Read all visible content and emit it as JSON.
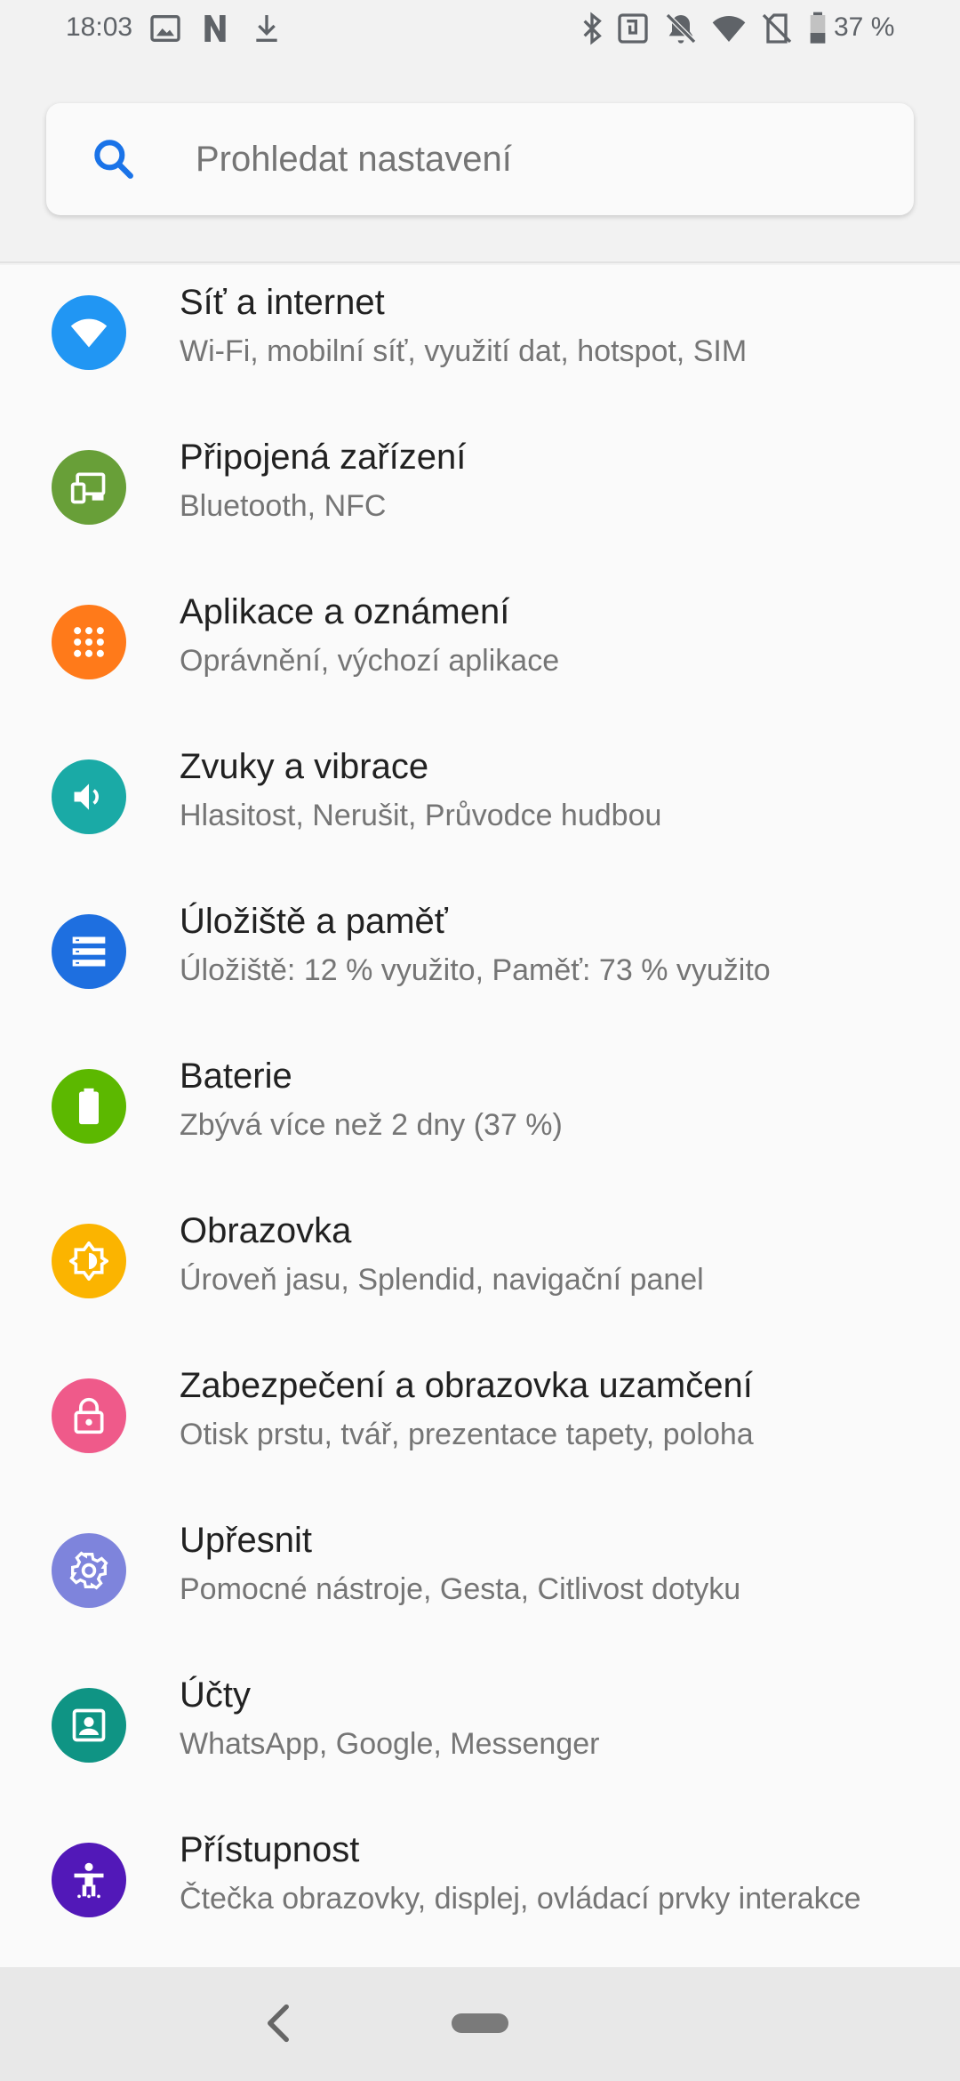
{
  "status_bar": {
    "time": "18:03",
    "battery_text": "37 %",
    "icons": [
      "image-icon",
      "n-app-icon",
      "download-icon",
      "bluetooth-icon",
      "nfc-icon",
      "mute-icon",
      "wifi-icon",
      "no-sim-icon",
      "battery-icon"
    ]
  },
  "search": {
    "placeholder": "Prohledat nastavení"
  },
  "settings": [
    {
      "title": "Síť a internet",
      "subtitle": "Wi-Fi, mobilní síť, využití dat, hotspot, SIM",
      "icon": "wifi-icon",
      "color": "#2196f3"
    },
    {
      "title": "Připojená zařízení",
      "subtitle": "Bluetooth, NFC",
      "icon": "devices-icon",
      "color": "#689f38"
    },
    {
      "title": "Aplikace a oznámení",
      "subtitle": "Oprávnění, výchozí aplikace",
      "icon": "apps-icon",
      "color": "#ff7a1a"
    },
    {
      "title": "Zvuky a vibrace",
      "subtitle": "Hlasitost, Nerušit, Průvodce hudbou",
      "icon": "volume-icon",
      "color": "#1aaaa6"
    },
    {
      "title": "Úložiště a paměť",
      "subtitle": "Úložiště: 12 % využito, Paměť: 73 % využito",
      "icon": "storage-icon",
      "color": "#1e6fe0"
    },
    {
      "title": "Baterie",
      "subtitle": "Zbývá více než 2 dny (37 %)",
      "icon": "battery-icon",
      "color": "#5cb800"
    },
    {
      "title": "Obrazovka",
      "subtitle": "Úroveň jasu, Splendid, navigační panel",
      "icon": "brightness-icon",
      "color": "#fbb400"
    },
    {
      "title": "Zabezpečení a obrazovka uzamčení",
      "subtitle": "Otisk prstu, tvář, prezentace tapety, poloha",
      "icon": "lock-icon",
      "color": "#ef5a8a"
    },
    {
      "title": "Upřesnit",
      "subtitle": "Pomocné nástroje, Gesta, Citlivost dotyku",
      "icon": "gear-icon",
      "color": "#7e84dc"
    },
    {
      "title": "Účty",
      "subtitle": "WhatsApp, Google, Messenger",
      "icon": "account-icon",
      "color": "#0f9484"
    },
    {
      "title": "Přístupnost",
      "subtitle": "Čtečka obrazovky, displej, ovládací prvky interakce",
      "icon": "accessibility-icon",
      "color": "#5218b8"
    }
  ],
  "nav_bar": {
    "back": "back-icon",
    "home": "home-pill"
  }
}
